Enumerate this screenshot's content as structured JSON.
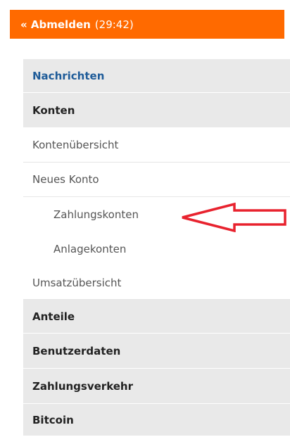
{
  "logout": {
    "label": "« Abmelden",
    "timer": "(29:42)"
  },
  "menu": {
    "nachrichten": "Nachrichten",
    "konten": "Konten",
    "kontenuebersicht": "Kontenübersicht",
    "neues_konto": "Neues Konto",
    "zahlungskonten": "Zahlungskonten",
    "anlagekonten": "Anlagekonten",
    "umsatzuebersicht": "Umsatzübersicht",
    "anteile": "Anteile",
    "benutzerdaten": "Benutzerdaten",
    "zahlungsverkehr": "Zahlungsverkehr",
    "bitcoin": "Bitcoin"
  },
  "colors": {
    "logout_bg": "#ff6a00",
    "section_bg": "#e9e9e9",
    "active_link": "#1f5c99",
    "annotation_arrow": "#e8222e"
  },
  "annotation": {
    "icon": "red-arrow-pointer-icon"
  }
}
